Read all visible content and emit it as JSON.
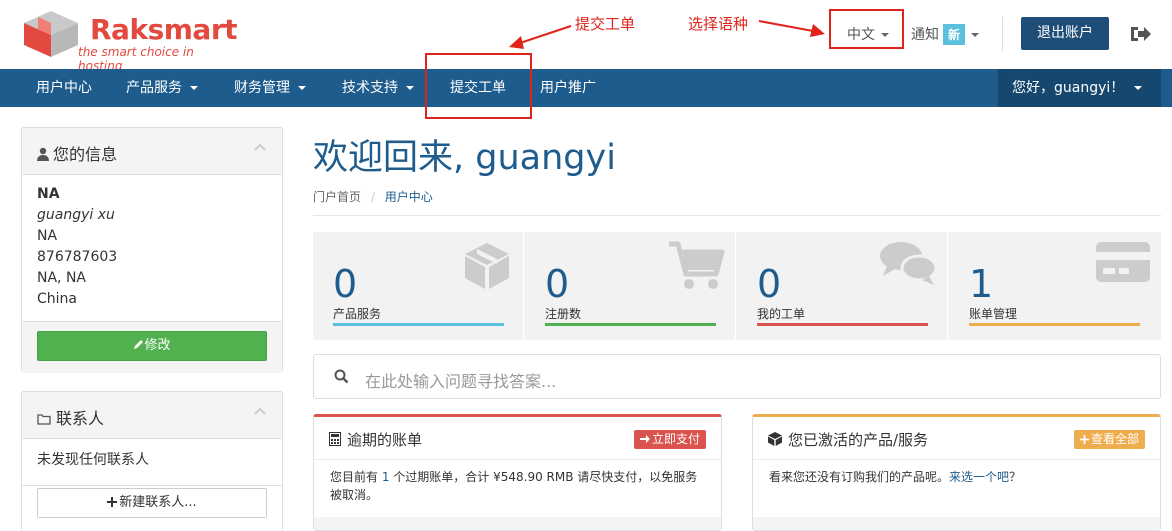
{
  "brand": {
    "name": "Raksmart",
    "tagline": "the smart choice in hosting"
  },
  "annotations": {
    "submit_ticket": "提交工单",
    "choose_language": "选择语种"
  },
  "header": {
    "language": "中文",
    "notify": "通知",
    "notify_badge": "新",
    "logout": "退出账户"
  },
  "nav": {
    "items": [
      "用户中心",
      "产品服务",
      "财务管理",
      "技术支持",
      "提交工单",
      "用户推广"
    ],
    "greeting": "您好，guangyi！"
  },
  "sidebar": {
    "info": {
      "title": "您的信息",
      "lines": [
        "NA",
        "guangyi xu",
        "NA",
        "876787603",
        "NA, NA",
        "China"
      ],
      "edit_button": "修改"
    },
    "contacts": {
      "title": "联系人",
      "empty": "未发现任何联系人",
      "new_button": "新建联系人..."
    }
  },
  "main": {
    "welcome_prefix": "欢迎回来",
    "welcome_name": ", guangyi",
    "breadcrumb": {
      "home": "门户首页",
      "sep": "/",
      "current": "用户中心"
    },
    "stats": [
      {
        "num": "0",
        "label": "产品服务",
        "color": "#5bc0de",
        "icon": "cube-icon"
      },
      {
        "num": "0",
        "label": "注册数",
        "color": "#51b14f",
        "icon": "cart-icon"
      },
      {
        "num": "0",
        "label": "我的工单",
        "color": "#d9534f",
        "icon": "comments-icon"
      },
      {
        "num": "1",
        "label": "账单管理",
        "color": "#f0ad4e",
        "icon": "credit-card-icon"
      }
    ],
    "search_placeholder": "在此处输入问题寻找答案...",
    "overdue": {
      "title": "逾期的账单",
      "button": "立即支付",
      "text_a": "您目前有 ",
      "count": "1",
      "text_b": " 个过期账单，合计 ¥548.90 RMB 请尽快支付，以免服务被取消。",
      "button_color": "#d9534f",
      "border_color": "#d9534f"
    },
    "active": {
      "title": "您已激活的产品/服务",
      "button": "查看全部",
      "text_a": "看来您还没有订购我们的产品呢。",
      "link": "来选一个吧",
      "text_b": "？",
      "button_color": "#f0ad4e",
      "border_color": "#f0ad4e"
    }
  }
}
